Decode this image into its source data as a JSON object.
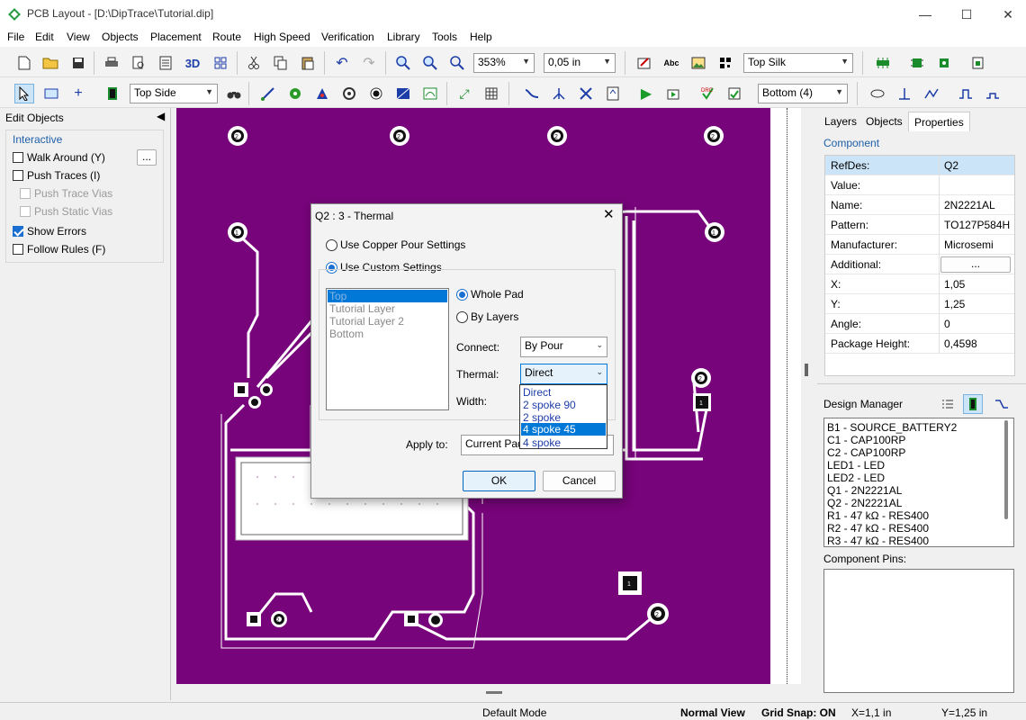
{
  "window": {
    "title": "PCB Layout - [D:\\DipTrace\\Tutorial.dip]"
  },
  "menu": [
    "File",
    "Edit",
    "View",
    "Objects",
    "Placement",
    "Route",
    "High Speed",
    "Verification",
    "Library",
    "Tools",
    "Help"
  ],
  "toolbar1": {
    "zoom": "353%",
    "grid": "0,05 in",
    "silk_layer": "Top Silk",
    "three_d": "3D"
  },
  "toolbar2": {
    "side": "Top Side",
    "layer": "Bottom (4)"
  },
  "left_panel": {
    "title": "Edit Objects",
    "group": "Interactive",
    "more_button": "...",
    "options": [
      {
        "label": "Walk Around (Y)",
        "checked": false,
        "enabled": true
      },
      {
        "label": "Push Traces (I)",
        "checked": false,
        "enabled": true
      },
      {
        "label": "Push Trace Vias",
        "checked": false,
        "enabled": false
      },
      {
        "label": "Push Static Vias",
        "checked": false,
        "enabled": false
      },
      {
        "label": "Show Errors",
        "checked": true,
        "enabled": true
      },
      {
        "label": "Follow Rules (F)",
        "checked": false,
        "enabled": true
      }
    ]
  },
  "right_panel": {
    "tabs": [
      "Layers",
      "Objects",
      "Properties"
    ],
    "section": "Component",
    "properties": [
      {
        "k": "RefDes:",
        "v": "Q2"
      },
      {
        "k": "Value:",
        "v": ""
      },
      {
        "k": "Name:",
        "v": "2N2221AL"
      },
      {
        "k": "Pattern:",
        "v": "TO127P584H"
      },
      {
        "k": "Manufacturer:",
        "v": "Microsemi"
      },
      {
        "k": "Additional:",
        "v": "..."
      },
      {
        "k": "X:",
        "v": "1,05"
      },
      {
        "k": "Y:",
        "v": "1,25"
      },
      {
        "k": "Angle:",
        "v": "0"
      },
      {
        "k": "Package Height:",
        "v": "0,4598"
      }
    ],
    "design_manager": "Design Manager",
    "components": [
      "B1 - SOURCE_BATTERY2",
      "C1 - CAP100RP",
      "C2 - CAP100RP",
      "LED1 - LED",
      "LED2 - LED",
      "Q1 - 2N2221AL",
      "Q2 - 2N2221AL",
      "R1 - 47 kΩ - RES400",
      "R2 - 47 kΩ - RES400",
      "R3 - 47 kΩ - RES400"
    ],
    "pins_label": "Component Pins:"
  },
  "dialog": {
    "title": "Q2 : 3 - Thermal",
    "opt_pour": "Use Copper Pour Settings",
    "opt_custom": "Use Custom Settings",
    "layers": [
      "Top",
      "Tutorial Layer",
      "Tutorial Layer 2",
      "Bottom"
    ],
    "whole_pad": "Whole Pad",
    "by_layers": "By Layers",
    "connect_label": "Connect:",
    "connect_value": "By Pour",
    "thermal_label": "Thermal:",
    "thermal_value": "Direct",
    "width_label": "Width:",
    "thermal_options": [
      "Direct",
      "2 spoke 90",
      "2 spoke",
      "4 spoke 45",
      "4 spoke"
    ],
    "selected_option": "4 spoke 45",
    "apply_label": "Apply to:",
    "apply_value": "Current Pad",
    "ok": "OK",
    "cancel": "Cancel"
  },
  "status": {
    "mode": "Default Mode",
    "view": "Normal View",
    "snap": "Grid Snap: ON",
    "x": "X=1,1 in",
    "y": "Y=1,25 in"
  },
  "pads": [
    "2",
    "2",
    "2",
    "2",
    "1",
    "1",
    "2",
    "1",
    "2",
    "1",
    "2"
  ],
  "colors": {
    "board": "#77047a",
    "accent": "#1a6fd1",
    "select": "#0078d7"
  }
}
